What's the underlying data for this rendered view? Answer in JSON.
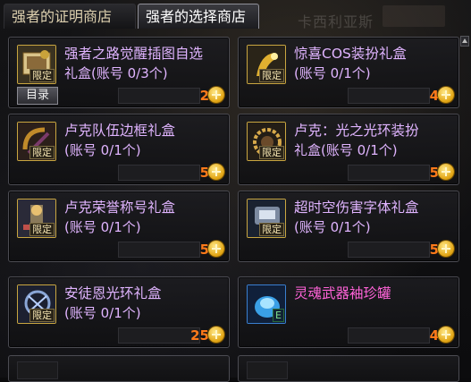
{
  "tabs": [
    {
      "label": "强者的证明商店",
      "active": false
    },
    {
      "label": "强者的选择商店",
      "active": true
    }
  ],
  "background_text": "卡西利亚斯",
  "catalog_label": "目录",
  "items": [
    {
      "title": "强者之路觉醒插图自选",
      "subtitle": "礼盒(账号 0/3个)",
      "price": "2",
      "limited_label": "限定",
      "icon": "scroll-icon",
      "accent": "#c9a640"
    },
    {
      "title": "惊喜COS装扮礼盒",
      "subtitle": "(账号 0/1个)",
      "price": "4",
      "limited_label": "限定",
      "icon": "costume-icon",
      "accent": "#c9a640"
    },
    {
      "title": "卢克队伍边框礼盒",
      "subtitle": "(账号 0/1个)",
      "price": "5",
      "limited_label": "限定",
      "icon": "frame-icon",
      "accent": "#c9a640"
    },
    {
      "title": "卢克：光之光环装扮",
      "subtitle": "礼盒(账号 0/1个)",
      "price": "5",
      "limited_label": "限定",
      "icon": "halo-icon",
      "accent": "#c9a640"
    },
    {
      "title": "卢克荣誉称号礼盒",
      "subtitle": "(账号 0/1个)",
      "price": "5",
      "limited_label": "限定",
      "icon": "title-badge-icon",
      "accent": "#c9a640"
    },
    {
      "title": "超时空伤害字体礼盒",
      "subtitle": "(账号 0/1个)",
      "price": "5",
      "limited_label": "限定",
      "icon": "font-box-icon",
      "accent": "#c9a640"
    },
    {
      "title": "安徒恩光环礼盒",
      "subtitle": "(账号 0/1个)",
      "price": "25",
      "limited_label": "限定",
      "icon": "anton-halo-icon",
      "accent": "#c9a640"
    },
    {
      "title": "灵魂武器袖珍罐",
      "subtitle": "",
      "price": "4",
      "limited_label": "E",
      "icon": "soul-jar-icon",
      "accent": "#3a7fd0"
    }
  ],
  "colors": {
    "item_text": "#e0b4ff",
    "item_text_highlight": "#ff63d8",
    "price_text": "#ff7a1a",
    "coin_gold": "#e2a514"
  }
}
